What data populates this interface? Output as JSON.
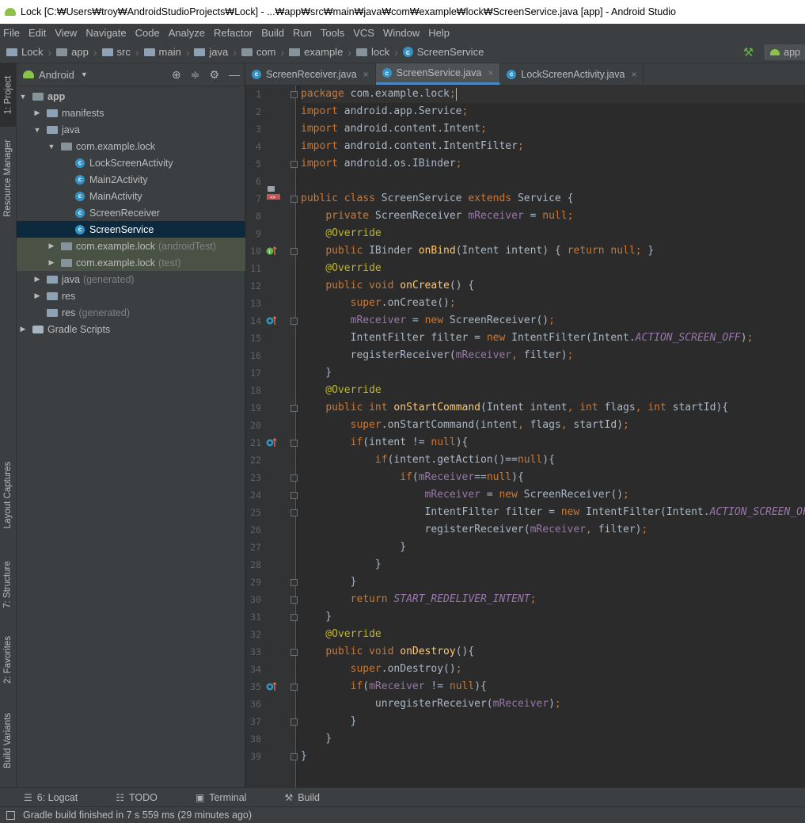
{
  "title": "Lock [C:₩Users₩troy₩AndroidStudioProjects₩Lock] - ...₩app₩src₩main₩java₩com₩example₩lock₩ScreenService.java [app] - Android Studio",
  "menu": [
    "File",
    "Edit",
    "View",
    "Navigate",
    "Code",
    "Analyze",
    "Refactor",
    "Build",
    "Run",
    "Tools",
    "VCS",
    "Window",
    "Help"
  ],
  "breadcrumb": [
    "Lock",
    "app",
    "src",
    "main",
    "java",
    "com",
    "example",
    "lock",
    "ScreenService"
  ],
  "run_config": "app",
  "left_tabs": [
    "1: Project",
    "Resource Manager",
    "Layout Captures",
    "7: Structure",
    "2: Favorites",
    "Build Variants"
  ],
  "project_panel": {
    "view": "Android",
    "tree": [
      {
        "label": "app",
        "extra": ""
      },
      {
        "label": "manifests",
        "extra": ""
      },
      {
        "label": "java",
        "extra": ""
      },
      {
        "label": "com.example.lock",
        "extra": ""
      },
      {
        "label": "LockScreenActivity",
        "extra": ""
      },
      {
        "label": "Main2Activity",
        "extra": ""
      },
      {
        "label": "MainActivity",
        "extra": ""
      },
      {
        "label": "ScreenReceiver",
        "extra": ""
      },
      {
        "label": "ScreenService",
        "extra": ""
      },
      {
        "label": "com.example.lock",
        "extra": "(androidTest)"
      },
      {
        "label": "com.example.lock",
        "extra": "(test)"
      },
      {
        "label": "java",
        "extra": "(generated)"
      },
      {
        "label": "res",
        "extra": ""
      },
      {
        "label": "res",
        "extra": "(generated)"
      },
      {
        "label": "Gradle Scripts",
        "extra": ""
      }
    ]
  },
  "editor_tabs": [
    "ScreenReceiver.java",
    "ScreenService.java",
    "LockScreenActivity.java"
  ],
  "active_tab": "ScreenService.java",
  "code_lines": [
    "package com.example.lock;",
    "import android.app.Service;",
    "import android.content.Intent;",
    "import android.content.IntentFilter;",
    "import android.os.IBinder;",
    "",
    "public class ScreenService extends Service {",
    "    private ScreenReceiver mReceiver = null;",
    "    @Override",
    "    public IBinder onBind(Intent intent) { return null; }",
    "    @Override",
    "    public void onCreate() {",
    "        super.onCreate();",
    "        mReceiver = new ScreenReceiver();",
    "        IntentFilter filter = new IntentFilter(Intent.ACTION_SCREEN_OFF);",
    "        registerReceiver(mReceiver, filter);",
    "    }",
    "    @Override",
    "    public int onStartCommand(Intent intent, int flags, int startId){",
    "        super.onStartCommand(intent, flags, startId);",
    "        if(intent != null){",
    "            if(intent.getAction()==null){",
    "                if(mReceiver==null){",
    "                    mReceiver = new ScreenReceiver();",
    "                    IntentFilter filter = new IntentFilter(Intent.ACTION_SCREEN_OFF);",
    "                    registerReceiver(mReceiver, filter);",
    "                }",
    "            }",
    "        }",
    "        return START_REDELIVER_INTENT;",
    "    }",
    "    @Override",
    "    public void onDestroy(){",
    "        super.onDestroy();",
    "        if(mReceiver != null){",
    "            unregisterReceiver(mReceiver);",
    "        }",
    "    }",
    "}"
  ],
  "bottom_tabs": [
    "6: Logcat",
    "TODO",
    "Terminal",
    "Build"
  ],
  "status": "Gradle build finished in 7 s 559 ms (29 minutes ago)"
}
